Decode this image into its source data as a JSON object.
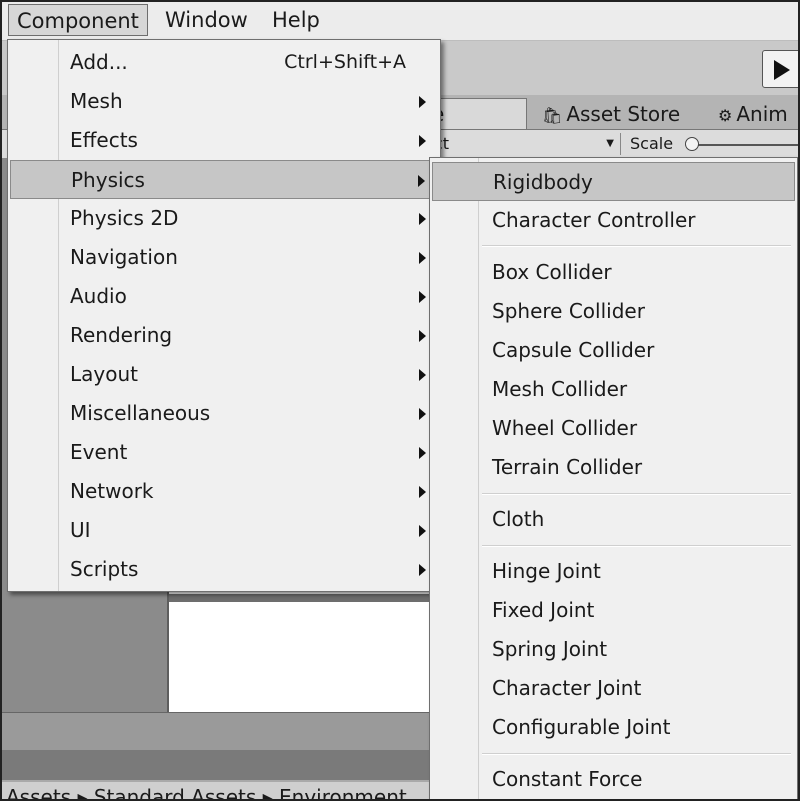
{
  "menubar": {
    "items": [
      "Component",
      "Window",
      "Help"
    ]
  },
  "editor": {
    "tabs": {
      "scene_fragment": "e",
      "asset_store": "Asset Store",
      "animation_fragment": "Anim"
    },
    "subbar": {
      "dropdown_fragment": "ct",
      "scale_label": "Scale"
    },
    "breadcrumb": "Assets ▸ Standard Assets ▸ Environment"
  },
  "component_menu": {
    "items": [
      {
        "label": "Add...",
        "shortcut": "Ctrl+Shift+A",
        "submenu": false
      },
      {
        "label": "Mesh",
        "submenu": true
      },
      {
        "label": "Effects",
        "submenu": true
      },
      {
        "label": "Physics",
        "submenu": true,
        "highlighted": true
      },
      {
        "label": "Physics 2D",
        "submenu": true
      },
      {
        "label": "Navigation",
        "submenu": true
      },
      {
        "label": "Audio",
        "submenu": true
      },
      {
        "label": "Rendering",
        "submenu": true
      },
      {
        "label": "Layout",
        "submenu": true
      },
      {
        "label": "Miscellaneous",
        "submenu": true
      },
      {
        "label": "Event",
        "submenu": true
      },
      {
        "label": "Network",
        "submenu": true
      },
      {
        "label": "UI",
        "submenu": true
      },
      {
        "label": "Scripts",
        "submenu": true
      }
    ]
  },
  "physics_submenu": {
    "items": [
      {
        "label": "Rigidbody",
        "highlighted": true
      },
      {
        "label": "Character Controller"
      },
      {
        "label": "Box Collider"
      },
      {
        "label": "Sphere Collider"
      },
      {
        "label": "Capsule Collider"
      },
      {
        "label": "Mesh Collider"
      },
      {
        "label": "Wheel Collider"
      },
      {
        "label": "Terrain Collider"
      },
      {
        "label": "Cloth"
      },
      {
        "label": "Hinge Joint"
      },
      {
        "label": "Fixed Joint"
      },
      {
        "label": "Spring Joint"
      },
      {
        "label": "Character Joint"
      },
      {
        "label": "Configurable Joint"
      },
      {
        "label": "Constant Force"
      }
    ]
  }
}
